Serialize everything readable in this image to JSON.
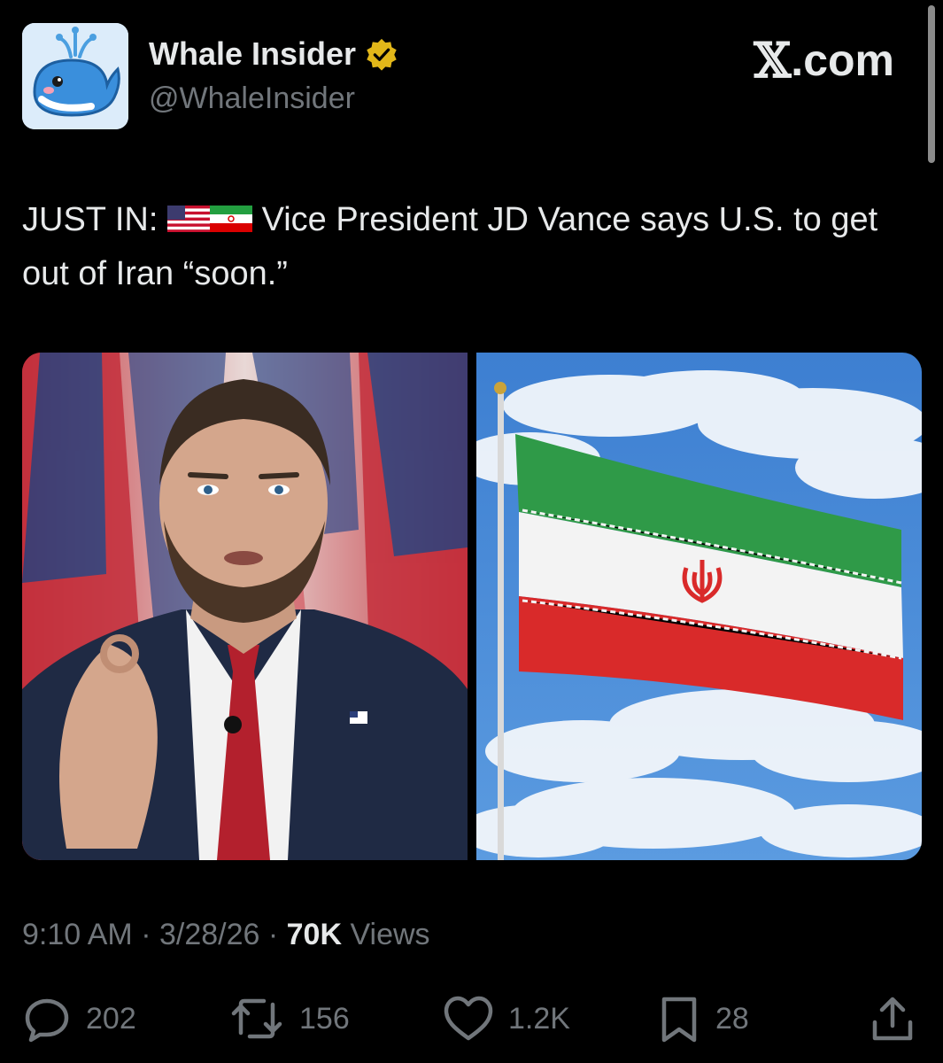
{
  "author": {
    "name": "Whale Insider",
    "handle": "@WhaleInsider",
    "verified_color": "#e2b719"
  },
  "brand": {
    "x_glyph": "𝕏",
    "suffix": ".com"
  },
  "tweet": {
    "prefix": "JUST IN:",
    "flags": [
      "us-flag-icon",
      "iran-flag-icon"
    ],
    "body": "Vice President JD Vance says U.S. to get out of Iran “soon.”"
  },
  "media": [
    {
      "name": "photo-jd-vance",
      "description_icon": "person-photo"
    },
    {
      "name": "photo-iran-flag",
      "description_icon": "flag-photo"
    }
  ],
  "meta": {
    "time": "9:10 AM",
    "date": "3/28/26",
    "views_count": "70K",
    "views_label": "Views",
    "separator": " · "
  },
  "actions": {
    "replies": "202",
    "reposts": "156",
    "likes": "1.2K",
    "bookmarks": "28"
  }
}
